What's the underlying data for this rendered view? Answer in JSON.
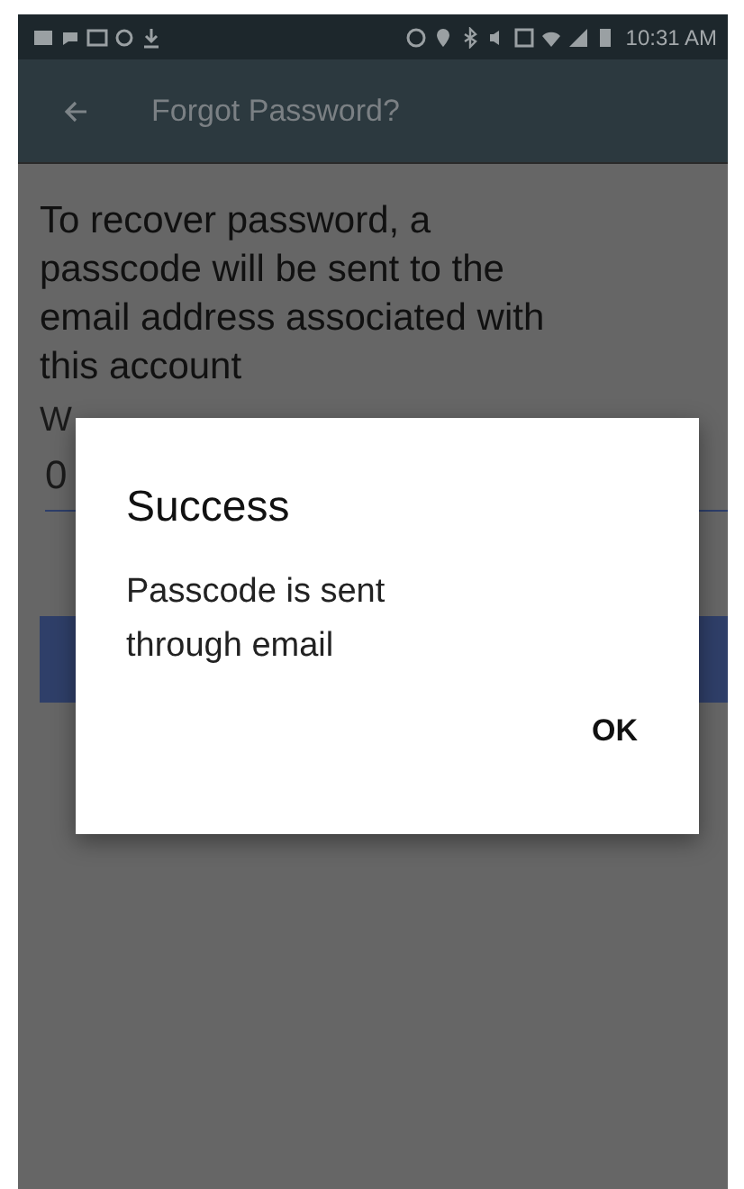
{
  "status_bar": {
    "time": "10:31 AM"
  },
  "app_bar": {
    "title": "Forgot Password?"
  },
  "instructions": "To recover password, a passcode will be sent to the email address associated with this account",
  "field": {
    "label": "W",
    "value": "0"
  },
  "dialog": {
    "title": "Success",
    "message": "Passcode is sent through email",
    "buttons": [
      "OK"
    ]
  }
}
